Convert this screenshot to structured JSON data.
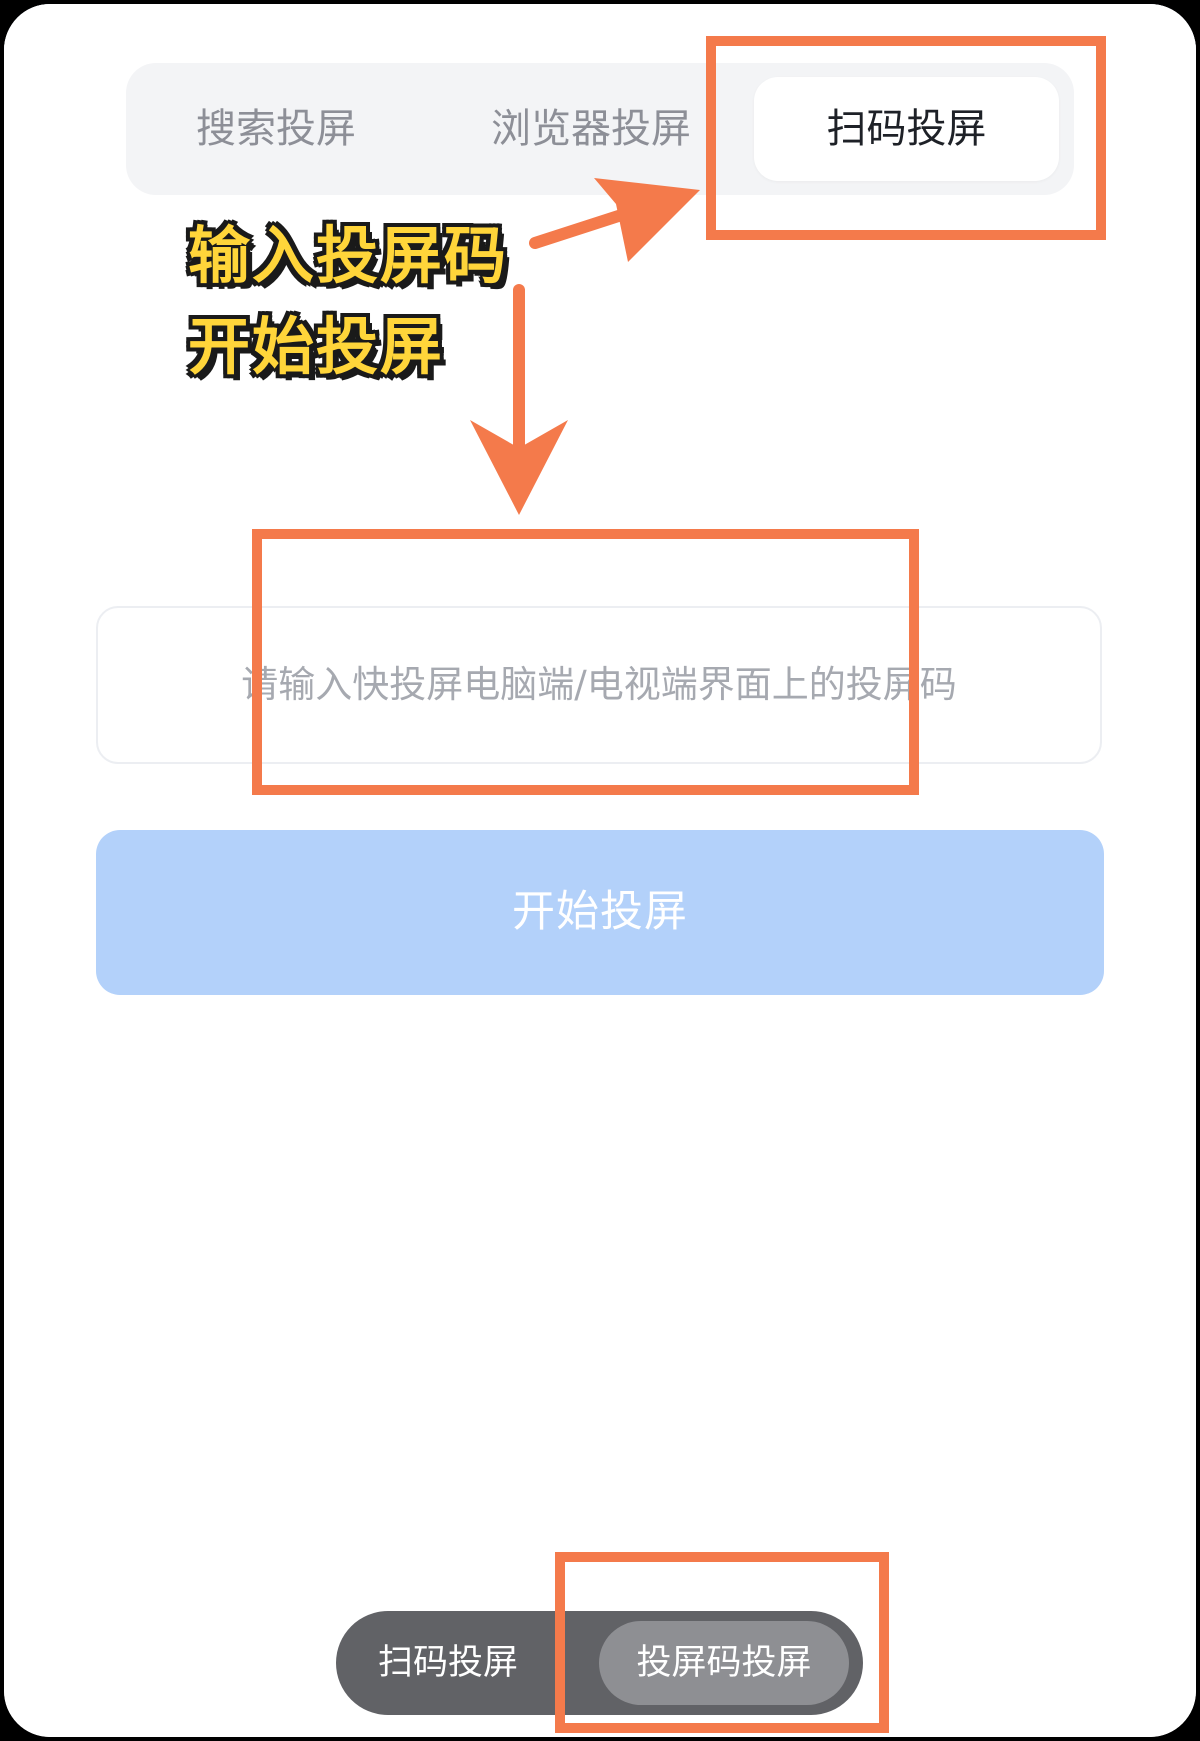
{
  "tabs": [
    {
      "label": "搜索投屏",
      "active": false
    },
    {
      "label": "浏览器投屏",
      "active": false
    },
    {
      "label": "扫码投屏",
      "active": true
    }
  ],
  "code_input": {
    "placeholder": "请输入快投屏电脑端/电视端界面上的投屏码"
  },
  "start_button": {
    "label": "开始投屏"
  },
  "bottom_switch": {
    "left_label": "扫码投屏",
    "right_label": "投屏码投屏",
    "selected": "投屏码投屏"
  },
  "annotation": {
    "line1": "输入投屏码",
    "line2": "开始投屏"
  },
  "colors": {
    "accent_annotation": "#f47a4b",
    "annotation_text": "#ffd53a",
    "button_disabled": "#b3d1fa"
  }
}
